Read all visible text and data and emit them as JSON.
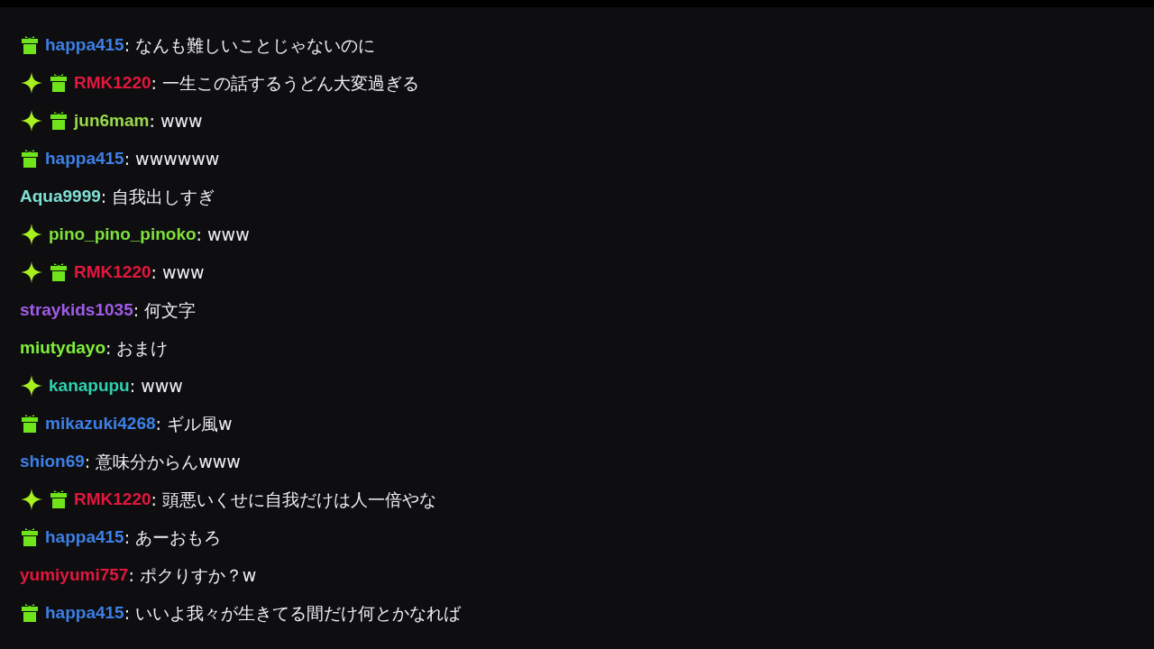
{
  "messages": [
    {
      "badges": [
        {
          "kind": "gift"
        }
      ],
      "user": "happa415",
      "color": "#3d7fe6",
      "separator": ":",
      "text": "なんも難しいことじゃないのに"
    },
    {
      "badges": [
        {
          "kind": "sparkle"
        },
        {
          "kind": "gift"
        }
      ],
      "user": "RMK1220",
      "color": "#e3173e",
      "separator": ":",
      "text": "一生この話するうどん大変過ぎる"
    },
    {
      "badges": [
        {
          "kind": "sparkle"
        },
        {
          "kind": "gift"
        }
      ],
      "user": "jun6mam",
      "color": "#9bd94a",
      "separator": ":",
      "text": "www"
    },
    {
      "badges": [
        {
          "kind": "gift"
        }
      ],
      "user": "happa415",
      "color": "#3d7fe6",
      "separator": ":",
      "text": "wwwwww"
    },
    {
      "user": "Aqua9999",
      "color": "#7fe0d6",
      "separator": ":",
      "text": "自我出しすぎ"
    },
    {
      "badges": [
        {
          "kind": "sparkle"
        }
      ],
      "user": "pino_pino_pinoko",
      "color": "#7ee03a",
      "separator": ":",
      "text": "www"
    },
    {
      "badges": [
        {
          "kind": "sparkle"
        },
        {
          "kind": "gift"
        }
      ],
      "user": "RMK1220",
      "color": "#e3173e",
      "separator": ":",
      "text": "www"
    },
    {
      "user": "straykids1035",
      "color": "#a05be8",
      "separator": ":",
      "text": "何文字"
    },
    {
      "user": "miutydayo",
      "color": "#7ef03a",
      "separator": ":",
      "text": "おまけ"
    },
    {
      "badges": [
        {
          "kind": "sparkle"
        }
      ],
      "user": "kanapupu",
      "color": "#2fd1b0",
      "separator": ":",
      "text": "www"
    },
    {
      "badges": [
        {
          "kind": "gift"
        }
      ],
      "user": "mikazuki4268",
      "color": "#3d7fe6",
      "separator": ":",
      "text": "ギル風w"
    },
    {
      "user": "shion69",
      "color": "#3d7fe6",
      "separator": ":",
      "text": "意味分からんwww"
    },
    {
      "badges": [
        {
          "kind": "sparkle"
        },
        {
          "kind": "gift"
        }
      ],
      "user": "RMK1220",
      "color": "#e3173e",
      "separator": ":",
      "text": "頭悪いくせに自我だけは人一倍やな"
    },
    {
      "badges": [
        {
          "kind": "gift"
        }
      ],
      "user": "happa415",
      "color": "#3d7fe6",
      "separator": ":",
      "text": "あーおもろ"
    },
    {
      "user": "yumiyumi757",
      "color": "#e3173e",
      "separator": ":",
      "text": "ポクりすか？w"
    },
    {
      "badges": [
        {
          "kind": "gift"
        }
      ],
      "user": "happa415",
      "color": "#3d7fe6",
      "separator": ":",
      "text": "いいよ我々が生きてる間だけ何とかなれば"
    }
  ]
}
